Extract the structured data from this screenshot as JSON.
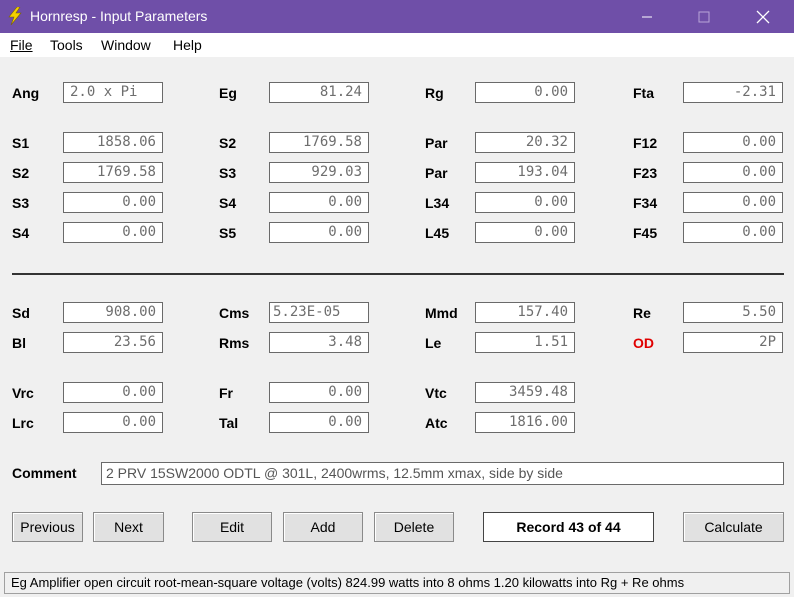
{
  "window": {
    "title": "Hornresp - Input Parameters"
  },
  "menu": {
    "file": "File",
    "tools": "Tools",
    "window": "Window",
    "help": "Help"
  },
  "throat": {
    "ang": {
      "label": "Ang",
      "value": "2.0 x Pi"
    },
    "eg": {
      "label": "Eg",
      "value": "81.24"
    },
    "rg": {
      "label": "Rg",
      "value": "0.00"
    },
    "fta": {
      "label": "Fta",
      "value": "-2.31"
    }
  },
  "horn": {
    "row1": [
      {
        "label": "S1",
        "value": "1858.06"
      },
      {
        "label": "S2",
        "value": "1769.58"
      },
      {
        "label": "Par",
        "value": "20.32"
      },
      {
        "label": "F12",
        "value": "0.00"
      }
    ],
    "row2": [
      {
        "label": "S2",
        "value": "1769.58"
      },
      {
        "label": "S3",
        "value": "929.03"
      },
      {
        "label": "Par",
        "value": "193.04"
      },
      {
        "label": "F23",
        "value": "0.00"
      }
    ],
    "row3": [
      {
        "label": "S3",
        "value": "0.00"
      },
      {
        "label": "S4",
        "value": "0.00"
      },
      {
        "label": "L34",
        "value": "0.00"
      },
      {
        "label": "F34",
        "value": "0.00"
      }
    ],
    "row4": [
      {
        "label": "S4",
        "value": "0.00"
      },
      {
        "label": "S5",
        "value": "0.00"
      },
      {
        "label": "L45",
        "value": "0.00"
      },
      {
        "label": "F45",
        "value": "0.00"
      }
    ]
  },
  "driver": {
    "sd": {
      "label": "Sd",
      "value": "908.00"
    },
    "cms": {
      "label": "Cms",
      "value": "5.23E-05"
    },
    "mmd": {
      "label": "Mmd",
      "value": "157.40"
    },
    "re": {
      "label": "Re",
      "value": "5.50"
    },
    "bl": {
      "label": "Bl",
      "value": "23.56"
    },
    "rms": {
      "label": "Rms",
      "value": "3.48"
    },
    "le": {
      "label": "Le",
      "value": "1.51"
    },
    "od": {
      "label": "OD",
      "value": "2P"
    }
  },
  "chambers": {
    "vrc": {
      "label": "Vrc",
      "value": "0.00"
    },
    "fr": {
      "label": "Fr",
      "value": "0.00"
    },
    "vtc": {
      "label": "Vtc",
      "value": "3459.48"
    },
    "lrc": {
      "label": "Lrc",
      "value": "0.00"
    },
    "tal": {
      "label": "Tal",
      "value": "0.00"
    },
    "atc": {
      "label": "Atc",
      "value": "1816.00"
    }
  },
  "comment": {
    "label": "Comment",
    "value": "2 PRV 15SW2000 ODTL @ 301L, 2400wrms, 12.5mm xmax, side by side"
  },
  "buttons": {
    "previous": "Previous",
    "next": "Next",
    "edit": "Edit",
    "add": "Add",
    "delete": "Delete",
    "calculate": "Calculate"
  },
  "record": "Record 43 of 44",
  "status": "Eg   Amplifier open circuit root-mean-square voltage  (volts)   824.99 watts into 8 ohms   1.20 kilowatts into Rg + Re ohms",
  "colors": {
    "titlebar": "#6f4fa8",
    "od_label": "#e00000",
    "field_text": "#6e6e6e"
  }
}
